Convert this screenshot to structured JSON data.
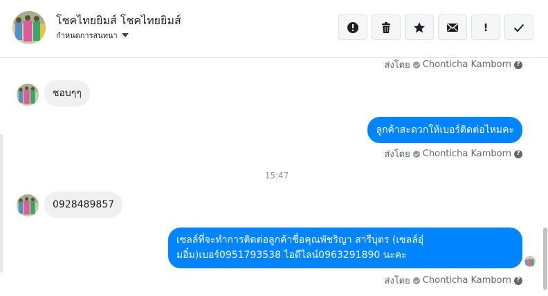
{
  "header": {
    "contact_name": "โชคไทยยิมส์ โชคไทยยิมส์",
    "assign_label": "กำหนดการสนทนา",
    "avatar_icon": "profile-photo-icon",
    "actions": [
      {
        "name": "mark-spam-button",
        "icon": "alert-circle-icon"
      },
      {
        "name": "delete-button",
        "icon": "trash-icon"
      },
      {
        "name": "star-button",
        "icon": "star-icon"
      },
      {
        "name": "mark-unread-button",
        "icon": "envelope-icon"
      },
      {
        "name": "follow-up-button",
        "icon": "exclamation-icon",
        "label": "!"
      },
      {
        "name": "mark-done-button",
        "icon": "checkmark-icon"
      }
    ]
  },
  "messages": {
    "sent_by_label": "ส่งโดย",
    "agent_name": "Chonticha Kamborn",
    "help_glyph": "?",
    "incoming_1": "ชอบๆๆ",
    "outgoing_1": "ลูกค้าสะดวกให้เบอร์ติดต่อไหมคะ",
    "timestamp": "15:47",
    "incoming_2": "0928489857",
    "outgoing_2_line1": "เซลล์ที่จะทำการติดต่อลูกค้าชื่อคุณพัชริญา สารีบุตร (เซลล์อุ๋",
    "outgoing_2_line2": "มอิ๋ม)เบอร์0951793538 ไอดีไลน์0963291890 นะคะ"
  },
  "colors": {
    "accent": "#0084ff",
    "incoming_bubble": "#f1f0f0",
    "border": "#dddfe2",
    "muted_text": "#606770"
  }
}
